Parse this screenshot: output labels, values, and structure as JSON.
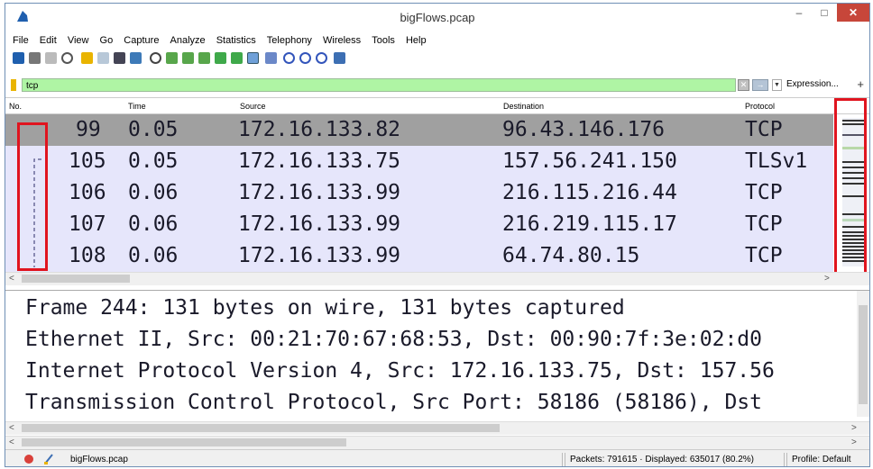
{
  "window": {
    "title": "bigFlows.pcap",
    "minimize": "–",
    "maximize": "□",
    "close": "✕"
  },
  "menu": [
    "File",
    "Edit",
    "View",
    "Go",
    "Capture",
    "Analyze",
    "Statistics",
    "Telephony",
    "Wireless",
    "Tools",
    "Help"
  ],
  "filter": {
    "value": "tcp",
    "expression_label": "Expression...",
    "add_label": "+"
  },
  "columns": {
    "no": "No.",
    "time": "Time",
    "source": "Source",
    "destination": "Destination",
    "protocol": "Protocol"
  },
  "packets": [
    {
      "no": "99",
      "time": "0.05",
      "source": "172.16.133.82",
      "destination": "96.43.146.176",
      "protocol": "TCP",
      "selected": true
    },
    {
      "no": "105",
      "time": "0.05",
      "source": "172.16.133.75",
      "destination": "157.56.241.150",
      "protocol": "TLSv1",
      "selected": false
    },
    {
      "no": "106",
      "time": "0.06",
      "source": "172.16.133.99",
      "destination": "216.115.216.44",
      "protocol": "TCP",
      "selected": false
    },
    {
      "no": "107",
      "time": "0.06",
      "source": "172.16.133.99",
      "destination": "216.219.115.17",
      "protocol": "TCP",
      "selected": false
    },
    {
      "no": "108",
      "time": "0.06",
      "source": "172.16.133.99",
      "destination": "64.74.80.15",
      "protocol": "TCP",
      "selected": false
    }
  ],
  "details": [
    "Frame 244: 131 bytes on wire, 131 bytes captured",
    "Ethernet II, Src: 00:21:70:67:68:53, Dst: 00:90:7f:3e:02:d0",
    "Internet Protocol Version 4, Src: 172.16.133.75, Dst: 157.56",
    "Transmission Control Protocol, Src Port: 58186 (58186), Dst"
  ],
  "status": {
    "file": "bigFlows.pcap",
    "packets": "Packets: 791615 · Displayed: 635017 (80.2%)",
    "profile": "Profile: Default"
  },
  "colors": {
    "highlight_box": "#e0141f",
    "filter_bg": "#aff5a4",
    "row_bg": "#e6e6fb",
    "selected_row_bg": "#a0a0a0"
  }
}
